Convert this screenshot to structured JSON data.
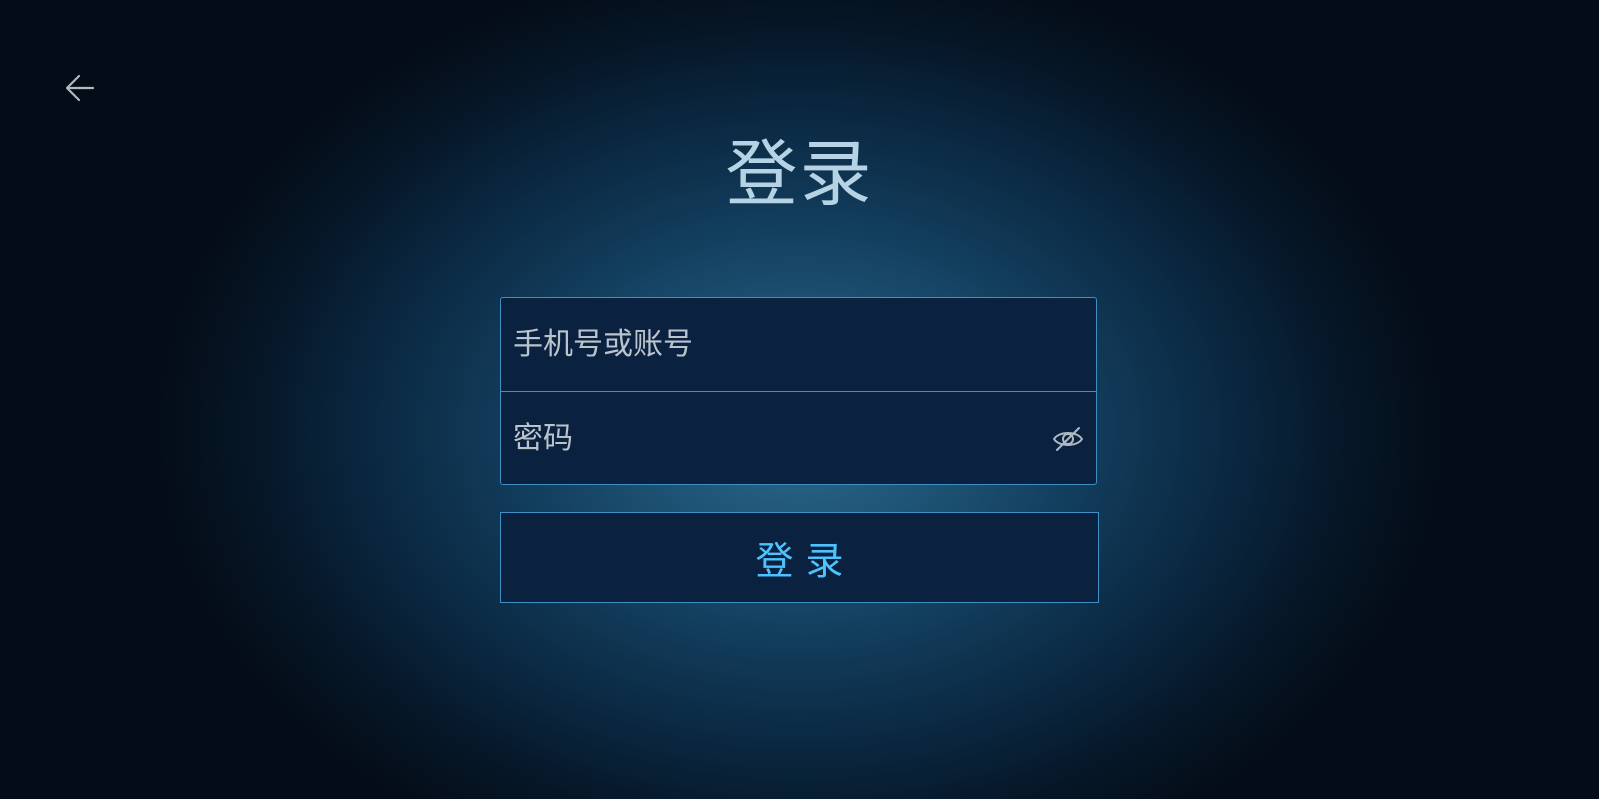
{
  "header": {
    "back_icon": "arrow-left-icon",
    "title": "登录"
  },
  "form": {
    "account": {
      "placeholder": "手机号或账号",
      "value": ""
    },
    "password": {
      "placeholder": "密码",
      "value": "",
      "toggle_icon": "eye-off-icon"
    }
  },
  "actions": {
    "login_label": "登录"
  },
  "colors": {
    "accent": "#4ec2ff",
    "border": "#3d8fc4",
    "field_bg": "#0b2140",
    "title": "#b5d3e4"
  }
}
